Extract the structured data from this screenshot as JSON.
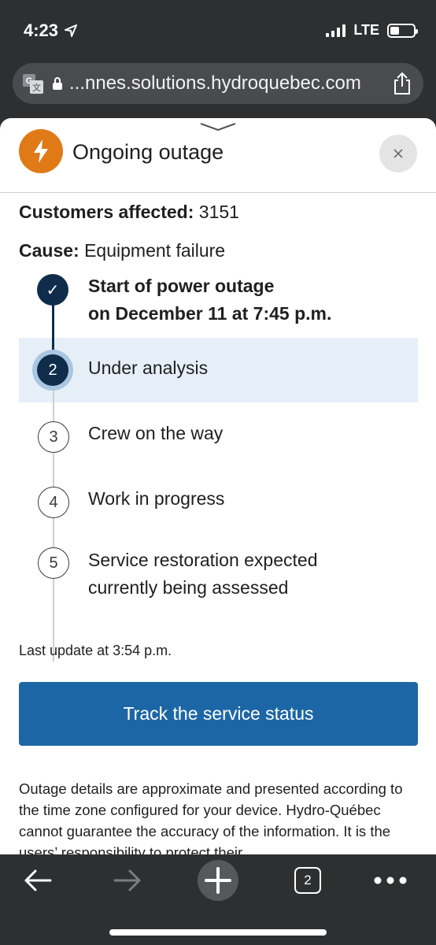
{
  "status_bar": {
    "time": "4:23",
    "network": "LTE",
    "battery_level": 0.4
  },
  "browser": {
    "url": "...nnes.solutions.hydroquebec.com",
    "tab_count": "2"
  },
  "outage": {
    "title": "Ongoing outage",
    "customers_label": "Customers affected:",
    "customers_value": "3151",
    "cause_label": "Cause:",
    "cause_value": "Equipment failure",
    "steps": [
      {
        "marker": "✓",
        "line1": "Start of power outage",
        "line2": "on December 11 at 7:45 p.m.",
        "state": "done"
      },
      {
        "marker": "2",
        "line1": "Under analysis",
        "line2": "",
        "state": "current"
      },
      {
        "marker": "3",
        "line1": "Crew on the way",
        "line2": "",
        "state": "todo"
      },
      {
        "marker": "4",
        "line1": "Work in progress",
        "line2": "",
        "state": "todo"
      },
      {
        "marker": "5",
        "line1": "Service restoration expected",
        "line2": "currently being assessed",
        "state": "todo"
      }
    ],
    "last_update": "Last update at 3:54 p.m.",
    "track_button": "Track the service status",
    "disclaimer": "Outage details are approximate and presented according to the time zone configured for your device. Hydro-Québec cannot guarantee the accuracy of the information. It is the users’ responsibility to protect their"
  },
  "colors": {
    "accent": "#e07a16",
    "primary": "#1d66a6",
    "dark_navy": "#0f2d4a",
    "highlight": "#e6eff8"
  }
}
